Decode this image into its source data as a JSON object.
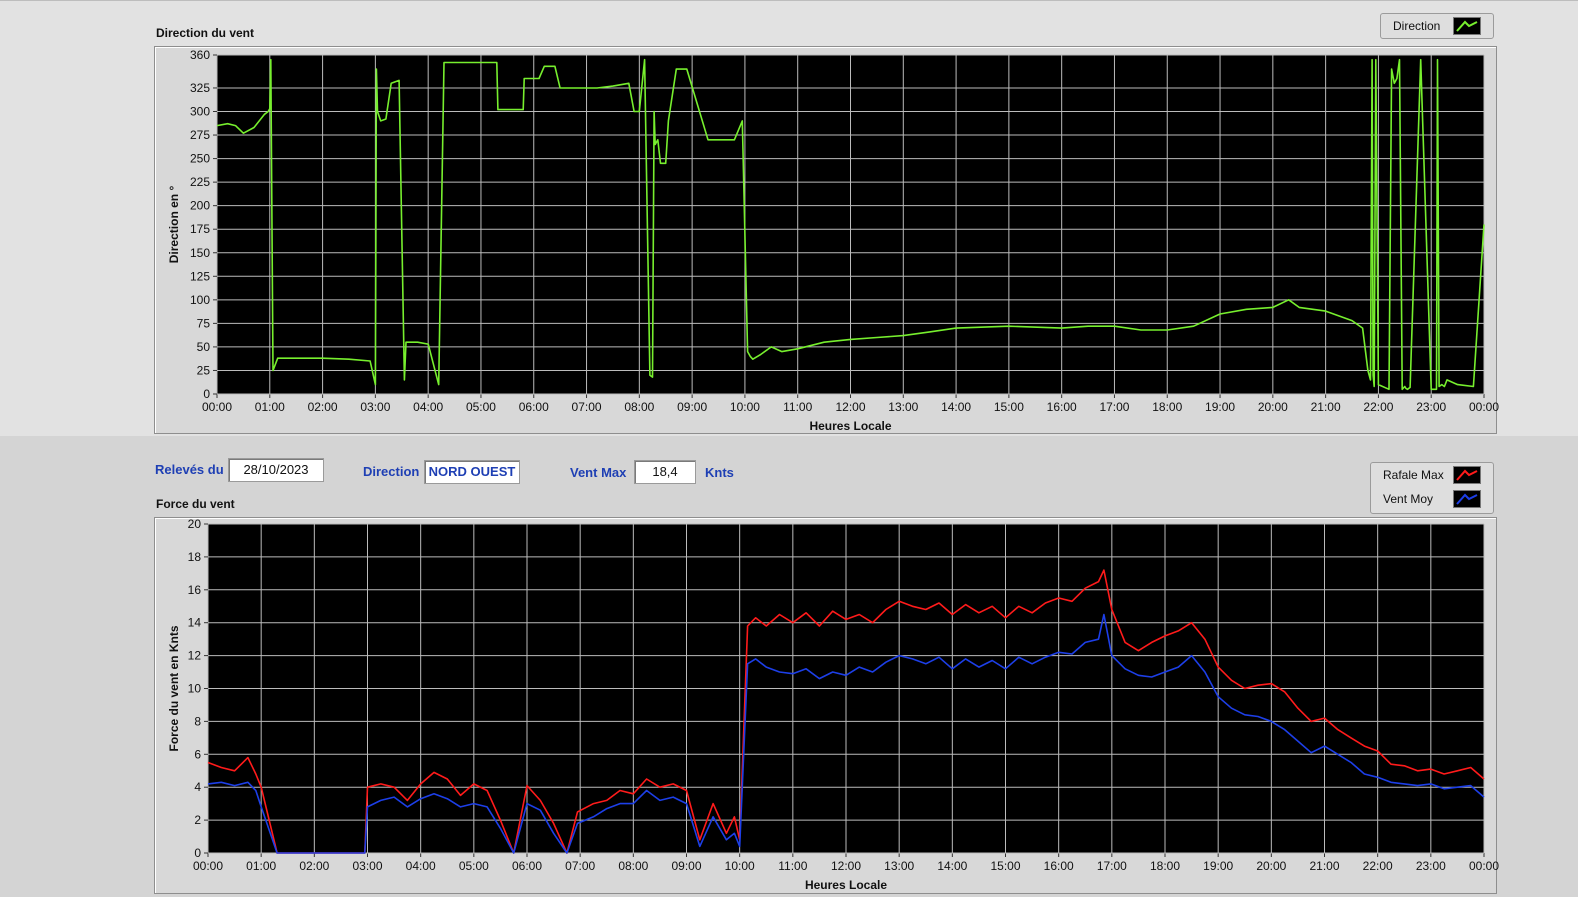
{
  "info": {
    "releves_label": "Relevés du",
    "date": "28/10/2023",
    "direction_label": "Direction",
    "direction_value": "NORD OUEST",
    "ventmax_label": "Vent Max",
    "ventmax_value": "18,4",
    "unit": "Knts"
  },
  "colors": {
    "direction": "#77ef2e",
    "rafale": "#ff1b1b",
    "vent_moy": "#1d3fe8"
  },
  "chart_data": [
    {
      "type": "line",
      "title": "Direction du vent",
      "xlabel": "Heures Locale",
      "ylabel": "Direction en °",
      "ylim": [
        0,
        360
      ],
      "yticks": [
        "0",
        "25",
        "50",
        "75",
        "100",
        "125",
        "150",
        "175",
        "200",
        "225",
        "250",
        "275",
        "300",
        "325",
        "360"
      ],
      "xticks": [
        "00:00",
        "01:00",
        "02:00",
        "03:00",
        "04:00",
        "05:00",
        "06:00",
        "07:00",
        "08:00",
        "09:00",
        "10:00",
        "11:00",
        "12:00",
        "13:00",
        "14:00",
        "15:00",
        "16:00",
        "17:00",
        "18:00",
        "19:00",
        "20:00",
        "21:00",
        "22:00",
        "23:00",
        "00:00"
      ],
      "grid": true,
      "legend_position": "top-right",
      "series": [
        {
          "name": "Direction",
          "x": [
            0,
            0.2,
            0.35,
            0.5,
            0.7,
            0.9,
            0.97,
            1.0,
            1.02,
            1.06,
            1.15,
            1.5,
            2.0,
            2.5,
            2.9,
            3.0,
            3.02,
            3.04,
            3.1,
            3.2,
            3.3,
            3.45,
            3.55,
            3.58,
            3.6,
            3.65,
            3.8,
            4.0,
            4.2,
            4.3,
            4.32,
            4.4,
            4.8,
            5.3,
            5.32,
            5.8,
            5.82,
            6.1,
            6.2,
            6.4,
            6.5,
            6.8,
            7.2,
            7.5,
            7.8,
            7.9,
            8.0,
            8.1,
            8.2,
            8.25,
            8.28,
            8.3,
            8.35,
            8.4,
            8.5,
            8.55,
            8.7,
            8.8,
            8.9,
            9.3,
            9.35,
            9.5,
            9.8,
            9.95,
            10.05,
            10.1,
            10.15,
            10.3,
            10.5,
            10.7,
            11.0,
            11.5,
            12.0,
            12.5,
            13.0,
            13.5,
            14.0,
            15.0,
            16.0,
            16.5,
            17.0,
            17.5,
            18.0,
            18.5,
            19.0,
            19.5,
            20.0,
            20.3,
            20.5,
            21.0,
            21.5,
            21.7,
            21.8,
            21.85,
            21.88,
            21.9,
            21.92,
            21.95,
            22.0,
            22.2,
            22.25,
            22.3,
            22.35,
            22.4,
            22.45,
            22.5,
            22.52,
            22.55,
            22.6,
            22.8,
            23.0,
            23.1,
            23.12,
            23.15,
            23.2,
            23.25,
            23.3,
            23.5,
            23.8,
            24.0
          ],
          "y": [
            285,
            287,
            285,
            277,
            283,
            297,
            300,
            303,
            355,
            25,
            38,
            38,
            38,
            37,
            35,
            10,
            345,
            300,
            290,
            292,
            330,
            333,
            15,
            55,
            55,
            55,
            55,
            53,
            10,
            352,
            352,
            352,
            352,
            352,
            302,
            302,
            335,
            335,
            348,
            348,
            325,
            325,
            325,
            327,
            330,
            300,
            300,
            355,
            20,
            18,
            300,
            265,
            270,
            245,
            245,
            290,
            345,
            345,
            345,
            270,
            270,
            270,
            270,
            290,
            45,
            40,
            37,
            42,
            50,
            45,
            48,
            55,
            58,
            60,
            62,
            66,
            70,
            72,
            70,
            72,
            72,
            68,
            68,
            72,
            85,
            90,
            92,
            100,
            92,
            88,
            78,
            70,
            25,
            15,
            355,
            20,
            8,
            355,
            10,
            5,
            345,
            330,
            335,
            355,
            5,
            8,
            6,
            5,
            7,
            355,
            5,
            5,
            355,
            8,
            10,
            8,
            15,
            10,
            8,
            180
          ]
        }
      ]
    },
    {
      "type": "line",
      "title": "Force du vent",
      "xlabel": "Heures Locale",
      "ylabel": "Force du vent en Knts",
      "ylim": [
        0,
        20
      ],
      "yticks": [
        "0",
        "2",
        "4",
        "6",
        "8",
        "10",
        "12",
        "14",
        "16",
        "18",
        "20"
      ],
      "xticks": [
        "00:00",
        "01:00",
        "02:00",
        "03:00",
        "04:00",
        "05:00",
        "06:00",
        "07:00",
        "08:00",
        "09:00",
        "10:00",
        "11:00",
        "12:00",
        "13:00",
        "14:00",
        "15:00",
        "16:00",
        "17:00",
        "18:00",
        "19:00",
        "20:00",
        "21:00",
        "22:00",
        "23:00",
        "00:00"
      ],
      "grid": true,
      "legend_position": "top-right",
      "x": [
        0,
        0.25,
        0.5,
        0.75,
        0.9,
        1.0,
        1.3,
        1.5,
        2.0,
        2.5,
        2.8,
        2.95,
        3.0,
        3.25,
        3.5,
        3.75,
        4.0,
        4.25,
        4.5,
        4.75,
        5.0,
        5.25,
        5.5,
        5.75,
        6.0,
        6.25,
        6.5,
        6.75,
        6.95,
        7.25,
        7.5,
        7.75,
        8.0,
        8.25,
        8.5,
        8.75,
        9.0,
        9.25,
        9.5,
        9.75,
        9.9,
        10.0,
        10.15,
        10.3,
        10.5,
        10.75,
        11.0,
        11.25,
        11.5,
        11.75,
        12.0,
        12.25,
        12.5,
        12.75,
        13.0,
        13.25,
        13.5,
        13.75,
        14.0,
        14.25,
        14.5,
        14.75,
        15.0,
        15.25,
        15.5,
        15.75,
        16.0,
        16.25,
        16.5,
        16.75,
        16.85,
        17.0,
        17.25,
        17.5,
        17.75,
        18.0,
        18.25,
        18.5,
        18.75,
        19.0,
        19.25,
        19.5,
        19.75,
        20.0,
        20.25,
        20.5,
        20.75,
        21.0,
        21.25,
        21.5,
        21.75,
        22.0,
        22.25,
        22.5,
        22.75,
        23.0,
        23.25,
        23.5,
        23.75,
        24.0
      ],
      "series": [
        {
          "name": "Rafale Max",
          "values": [
            5.5,
            5.2,
            5.0,
            5.8,
            4.8,
            4.0,
            0,
            0,
            0,
            0,
            0,
            0,
            4.0,
            4.2,
            4.0,
            3.2,
            4.2,
            4.9,
            4.5,
            3.5,
            4.2,
            3.8,
            2.0,
            0,
            4.1,
            3.2,
            1.8,
            0,
            2.5,
            3.0,
            3.2,
            3.8,
            3.6,
            4.5,
            4.0,
            4.2,
            3.8,
            0.8,
            3.0,
            1.2,
            2.2,
            0.8,
            13.8,
            14.3,
            13.8,
            14.5,
            14.0,
            14.6,
            13.8,
            14.7,
            14.2,
            14.5,
            14.0,
            14.8,
            15.3,
            15.0,
            14.8,
            15.2,
            14.5,
            15.1,
            14.6,
            15.0,
            14.3,
            15.0,
            14.6,
            15.2,
            15.5,
            15.3,
            16.1,
            16.5,
            17.2,
            14.8,
            12.8,
            12.3,
            12.8,
            13.2,
            13.5,
            14.0,
            13.0,
            11.3,
            10.5,
            10.0,
            10.2,
            10.3,
            9.8,
            8.8,
            8.0,
            8.2,
            7.5,
            7.0,
            6.5,
            6.2,
            5.4,
            5.3,
            5.0,
            5.1,
            4.8,
            5.0,
            5.2,
            4.5
          ]
        },
        {
          "name": "Vent Moy",
          "values": [
            4.2,
            4.3,
            4.1,
            4.3,
            3.8,
            2.8,
            0,
            0,
            0,
            0,
            0,
            0,
            2.8,
            3.2,
            3.4,
            2.8,
            3.3,
            3.6,
            3.3,
            2.8,
            3.0,
            2.8,
            1.5,
            0,
            3.0,
            2.6,
            1.2,
            0,
            1.8,
            2.2,
            2.7,
            3.0,
            3.0,
            3.8,
            3.2,
            3.4,
            3.0,
            0.4,
            2.2,
            0.8,
            1.2,
            0.4,
            11.5,
            11.8,
            11.3,
            11.0,
            10.9,
            11.2,
            10.6,
            11.0,
            10.8,
            11.3,
            11.0,
            11.6,
            12.0,
            11.8,
            11.5,
            11.9,
            11.2,
            11.8,
            11.3,
            11.7,
            11.2,
            11.9,
            11.5,
            11.9,
            12.2,
            12.1,
            12.8,
            13.0,
            14.5,
            12.0,
            11.2,
            10.8,
            10.7,
            11.0,
            11.3,
            12.0,
            11.0,
            9.5,
            8.8,
            8.4,
            8.3,
            8.0,
            7.5,
            6.8,
            6.1,
            6.5,
            6.0,
            5.5,
            4.8,
            4.6,
            4.3,
            4.2,
            4.1,
            4.2,
            3.9,
            4.0,
            4.1,
            3.4
          ]
        }
      ]
    }
  ]
}
